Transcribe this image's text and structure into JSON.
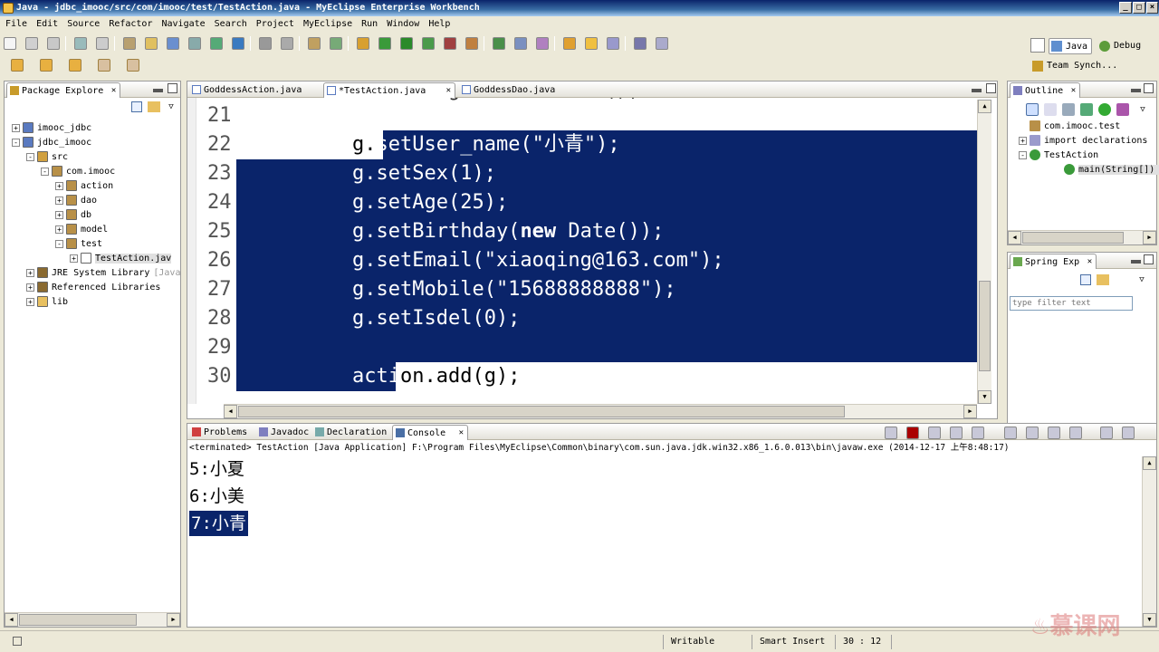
{
  "window": {
    "title": "Java - jdbc_imooc/src/com/imooc/test/TestAction.java - MyEclipse Enterprise Workbench"
  },
  "menu": [
    "File",
    "Edit",
    "Source",
    "Refactor",
    "Navigate",
    "Search",
    "Project",
    "MyEclipse",
    "Run",
    "Window",
    "Help"
  ],
  "perspectives": {
    "java": "Java",
    "debug": "Debug",
    "team": "Team Synch..."
  },
  "package_explorer": {
    "tab": "Package Explore",
    "tree": [
      {
        "label": "imooc_jdbc",
        "icon": "project-icon",
        "level": 0,
        "toggle": "+"
      },
      {
        "label": "jdbc_imooc",
        "icon": "project-icon",
        "level": 0,
        "toggle": "-"
      },
      {
        "label": "src",
        "icon": "source-folder-icon",
        "level": 1,
        "toggle": "-"
      },
      {
        "label": "com.imooc",
        "icon": "package-icon",
        "level": 2,
        "toggle": "-"
      },
      {
        "label": "action",
        "icon": "package-icon",
        "level": 3,
        "toggle": "+"
      },
      {
        "label": "dao",
        "icon": "package-icon",
        "level": 3,
        "toggle": "+"
      },
      {
        "label": "db",
        "icon": "package-icon",
        "level": 3,
        "toggle": "+"
      },
      {
        "label": "model",
        "icon": "package-icon",
        "level": 3,
        "toggle": "+"
      },
      {
        "label": "test",
        "icon": "package-icon",
        "level": 3,
        "toggle": "-"
      },
      {
        "label": "TestAction.jav",
        "icon": "java-file-icon",
        "level": 4,
        "toggle": "+"
      },
      {
        "label": "JRE System Library",
        "extra": "[Java",
        "icon": "library-icon",
        "level": 1,
        "toggle": "+"
      },
      {
        "label": "Referenced Libraries",
        "icon": "library-icon",
        "level": 1,
        "toggle": "+"
      },
      {
        "label": "lib",
        "icon": "folder-icon",
        "level": 1,
        "toggle": "+"
      }
    ]
  },
  "editor": {
    "tabs": [
      {
        "label": "GoddessAction.java",
        "active": false
      },
      {
        "label": "*TestAction.java",
        "active": true
      },
      {
        "label": "GoddessDao.java",
        "active": false
      }
    ],
    "partial_top_line": "Goddess g=new Goddess();",
    "lines": [
      {
        "num": "21",
        "pre": "",
        "kw": "",
        "post": ""
      },
      {
        "num": "22",
        "pre": "g.setUser_name(\"小青\");",
        "kw": "",
        "post": ""
      },
      {
        "num": "23",
        "pre": "g.setSex(1);",
        "kw": "",
        "post": ""
      },
      {
        "num": "24",
        "pre": "g.setAge(25);",
        "kw": "",
        "post": ""
      },
      {
        "num": "25",
        "pre": "g.setBirthday(",
        "kw": "new",
        "post": " Date());"
      },
      {
        "num": "26",
        "pre": "g.setEmail(\"xiaoqing@163.com\");",
        "kw": "",
        "post": ""
      },
      {
        "num": "27",
        "pre": "g.setMobile(\"15688888888\");",
        "kw": "",
        "post": ""
      },
      {
        "num": "28",
        "pre": "g.setIsdel(0);",
        "kw": "",
        "post": ""
      },
      {
        "num": "29",
        "pre": "",
        "kw": "",
        "post": ""
      },
      {
        "num": "30",
        "pre": "action.add(g);",
        "kw": "",
        "post": ""
      }
    ],
    "selection_color": "#0a246a"
  },
  "outline": {
    "tab": "Outline",
    "items": [
      {
        "label": "com.imooc.test",
        "level": 0
      },
      {
        "label": "import declarations",
        "level": 0
      },
      {
        "label": "TestAction",
        "level": 0
      },
      {
        "label": "main(String[]) : ",
        "level": 1
      }
    ]
  },
  "spring_explorer": {
    "tab": "Spring Exp",
    "filter_placeholder": "type filter text"
  },
  "console": {
    "tabs": [
      "Problems",
      "Javadoc",
      "Declaration",
      "Console"
    ],
    "active_tab": "Console",
    "header": "<terminated> TestAction [Java Application] F:\\Program Files\\MyEclipse\\Common\\binary\\com.sun.java.jdk.win32.x86_1.6.0.013\\bin\\javaw.exe (2014-12-17 上午8:48:17)",
    "lines": [
      "5:小夏",
      "6:小美",
      "7:小青"
    ]
  },
  "status": {
    "writable": "Writable",
    "insert_mode": "Smart Insert",
    "position": "30 : 12"
  },
  "watermark": "慕课网"
}
